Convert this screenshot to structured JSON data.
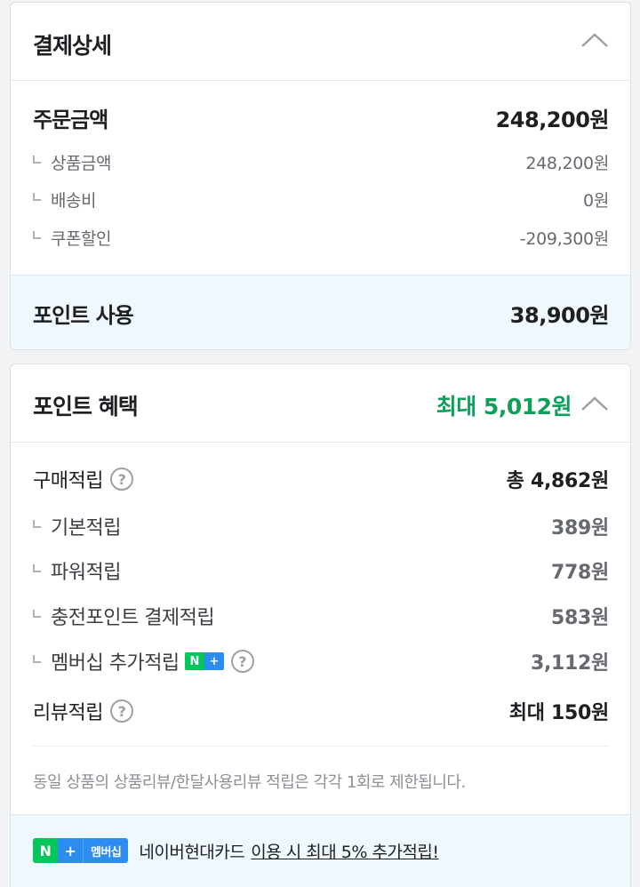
{
  "payment_detail": {
    "title": "결제상세",
    "order_amount": {
      "label": "주문금액",
      "value": "248,200원"
    },
    "sub_items": [
      {
        "label": "상품금액",
        "value": "248,200원"
      },
      {
        "label": "배송비",
        "value": "0원"
      },
      {
        "label": "쿠폰할인",
        "value": "-209,300원"
      }
    ],
    "point_use": {
      "label": "포인트 사용",
      "value": "38,900원"
    }
  },
  "point_benefit": {
    "title": "포인트 혜택",
    "max_label": "최대 5,012원",
    "purchase": {
      "label": "구매적립",
      "value": "총 4,862원"
    },
    "sub_items": [
      {
        "label": "기본적립",
        "value": "389원"
      },
      {
        "label": "파워적립",
        "value": "778원"
      },
      {
        "label": "충전포인트 결제적립",
        "value": "583원"
      },
      {
        "label": "멤버십 추가적립",
        "value": "3,112원"
      }
    ],
    "review": {
      "label": "리뷰적립",
      "value": "최대 150원"
    },
    "notice": "동일 상품의 상품리뷰/한달사용리뷰 적립은 각각 1회로 제한됩니다.",
    "badge": {
      "n": "N",
      "plus": "+"
    },
    "question_mark": "?",
    "promo": {
      "badge_n": "N",
      "badge_plus": "+",
      "badge_text": "멤버십",
      "text": "네이버현대카드",
      "link_text": "이용 시 최대 5% 추가적립!"
    }
  },
  "colors": {
    "accent_green": "#0e9f5a",
    "naver_green": "#03c75a",
    "plus_blue": "#2d8cf0",
    "band_bg": "#eef8fd"
  },
  "icons": [
    "chevron-up-icon",
    "question-circle-icon",
    "naver-plus-badge-icon"
  ]
}
